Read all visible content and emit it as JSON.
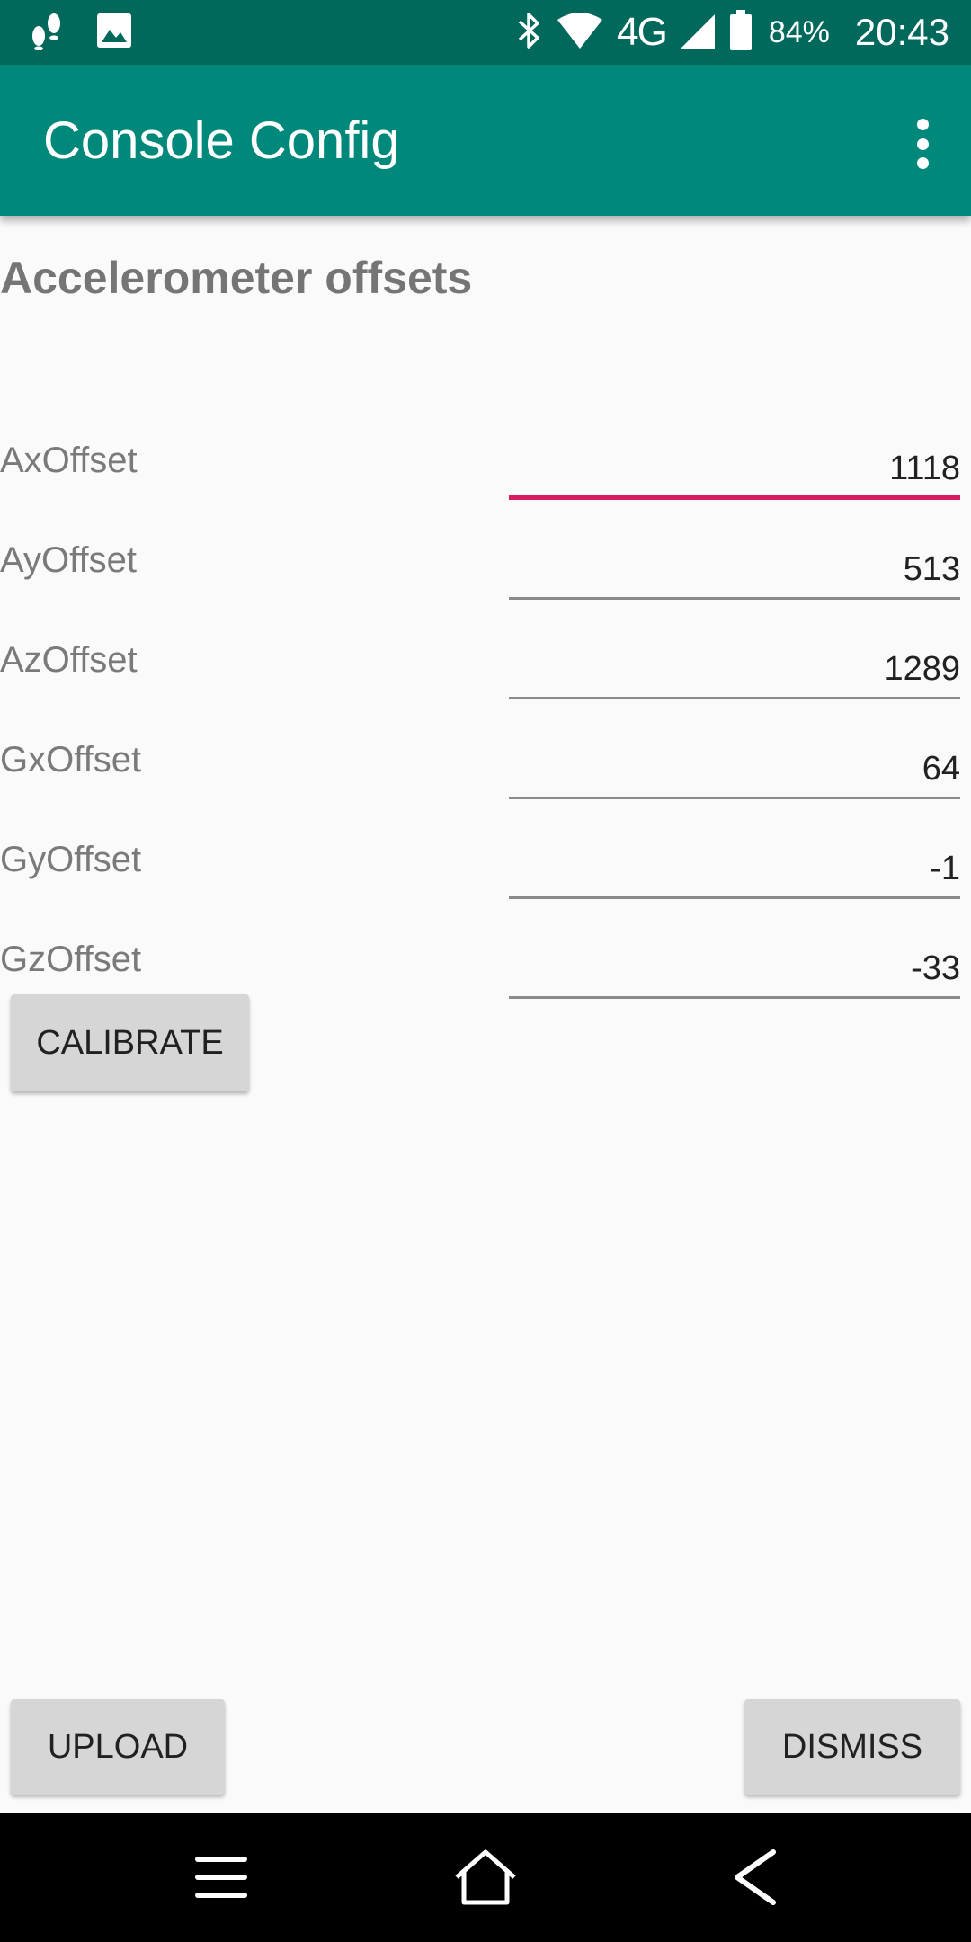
{
  "status_bar": {
    "network_label": "4G",
    "battery_percent": "84%",
    "time": "20:43",
    "icons": [
      "footsteps-icon",
      "image-icon",
      "bluetooth-icon",
      "wifi-icon",
      "cell-signal-icon",
      "battery-icon"
    ]
  },
  "app_bar": {
    "title": "Console Config",
    "menu_icon": "overflow-menu-icon"
  },
  "section": {
    "title": "Accelerometer offsets"
  },
  "fields": [
    {
      "label": "AxOffset",
      "value": "1118",
      "focused": true
    },
    {
      "label": "AyOffset",
      "value": "513",
      "focused": false
    },
    {
      "label": "AzOffset",
      "value": "1289",
      "focused": false
    },
    {
      "label": "GxOffset",
      "value": "64",
      "focused": false
    },
    {
      "label": "GyOffset",
      "value": "-1",
      "focused": false
    },
    {
      "label": "GzOffset",
      "value": "-33",
      "focused": false
    }
  ],
  "buttons": {
    "calibrate": "CALIBRATE",
    "upload": "UPLOAD",
    "dismiss": "DISMISS"
  },
  "nav_bar": {
    "icons": [
      "recent-apps-icon",
      "home-icon",
      "back-icon"
    ]
  },
  "colors": {
    "status_bar": "#00695c",
    "app_bar": "#00897b",
    "focus_accent": "#d81b60",
    "background": "#fafafa"
  }
}
